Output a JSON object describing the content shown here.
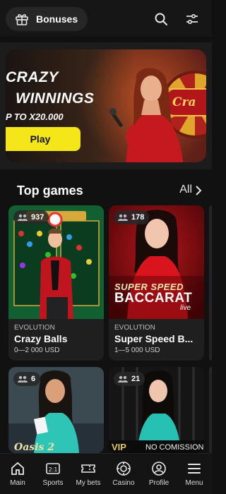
{
  "header": {
    "bonuses_label": "Bonuses",
    "icons": [
      "gift-icon",
      "search-icon",
      "filter-sliders-icon"
    ]
  },
  "banner": {
    "line1": "CRAZY",
    "line2": "WINNINGS",
    "line3": "P TO X20.000",
    "play_label": "Play",
    "badge_text": "Cra",
    "accent": "#f5e61a"
  },
  "top_games": {
    "title": "Top games",
    "all_label": "All",
    "cards": [
      {
        "players": "937",
        "provider": "EVOLUTION",
        "name": "Crazy Balls",
        "range": "0—2 000 USD",
        "thumb_text": ""
      },
      {
        "players": "178",
        "provider": "EVOLUTION",
        "name": "Super Speed B...",
        "range": "1—5 000 USD",
        "thumb_text": "SUPER SPEED",
        "thumb_text2": "BACCARAT",
        "thumb_text3": "live"
      },
      {
        "players": "6",
        "thumb_text": "Oasis 2"
      },
      {
        "players": "21",
        "thumb_text": "VIP",
        "thumb_text2": "NO COMISSION"
      }
    ]
  },
  "bottom_nav": {
    "items": [
      {
        "label": "Main",
        "icon": "home-icon"
      },
      {
        "label": "Sports",
        "icon": "scoreboard-icon"
      },
      {
        "label": "My bets",
        "icon": "ticket-icon"
      },
      {
        "label": "Casino",
        "icon": "casino-chip-icon"
      },
      {
        "label": "Profile",
        "icon": "profile-icon"
      },
      {
        "label": "Menu",
        "icon": "hamburger-menu-icon"
      }
    ]
  }
}
